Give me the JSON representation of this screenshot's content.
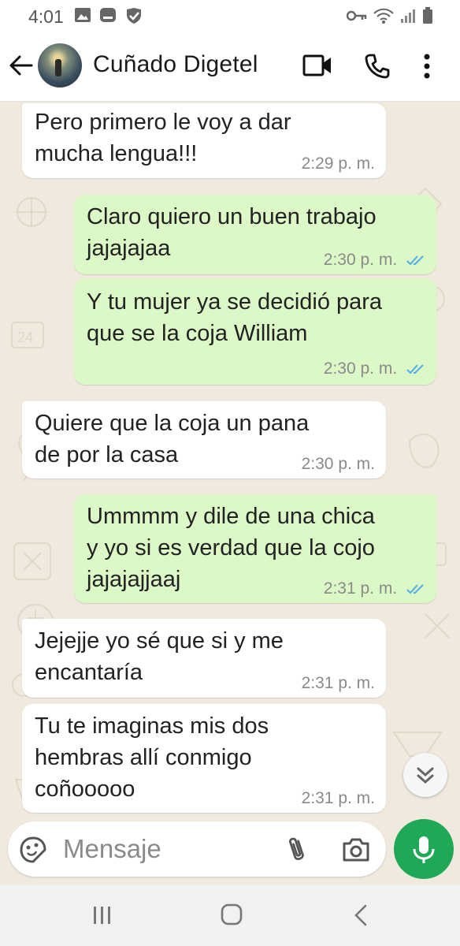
{
  "status_bar": {
    "time": "4:01",
    "left_icons": [
      "gallery-icon",
      "notification-icon",
      "check-shield-icon"
    ],
    "right_icons": [
      "key-icon",
      "wifi-icon",
      "signal-icon",
      "battery-icon"
    ]
  },
  "header": {
    "contact_name": "Cuñado Digetel",
    "actions": [
      "video-call-icon",
      "phone-icon",
      "more-icon"
    ]
  },
  "messages": [
    {
      "direction": "in",
      "text": "Pero primero le voy a dar\nmucha lengua!!!",
      "time": "2:29 p. m."
    },
    {
      "direction": "out",
      "text": "Claro quiero un buen trabajo\njajajajaa",
      "time": "2:30 p. m.",
      "read": true
    },
    {
      "direction": "out",
      "text": "Y tu mujer ya se decidió para\nque se la coja William",
      "time": "2:30 p. m.",
      "read": true
    },
    {
      "direction": "in",
      "text": "Quiere que la coja un pana\nde por la casa",
      "time": "2:30 p. m."
    },
    {
      "direction": "out",
      "text": "Ummmm y dile de una chica\ny yo si es verdad que la cojo\njajajajjaaj",
      "time": "2:31 p. m.",
      "read": true
    },
    {
      "direction": "in",
      "text": "Jejejje yo sé que si y me\nencantaría",
      "time": "2:31 p. m."
    },
    {
      "direction": "in",
      "text": "Tu te imaginas mis dos\nhembras allí conmigo\ncoñooooo",
      "time": "2:31 p. m."
    }
  ],
  "composer": {
    "placeholder": "Mensaje"
  },
  "colors": {
    "outgoing_bubble": "#dcf8c6",
    "incoming_bubble": "#ffffff",
    "chat_background": "#efe9de",
    "read_ticks": "#4fb0e8",
    "mic_button": "#1fa855"
  }
}
